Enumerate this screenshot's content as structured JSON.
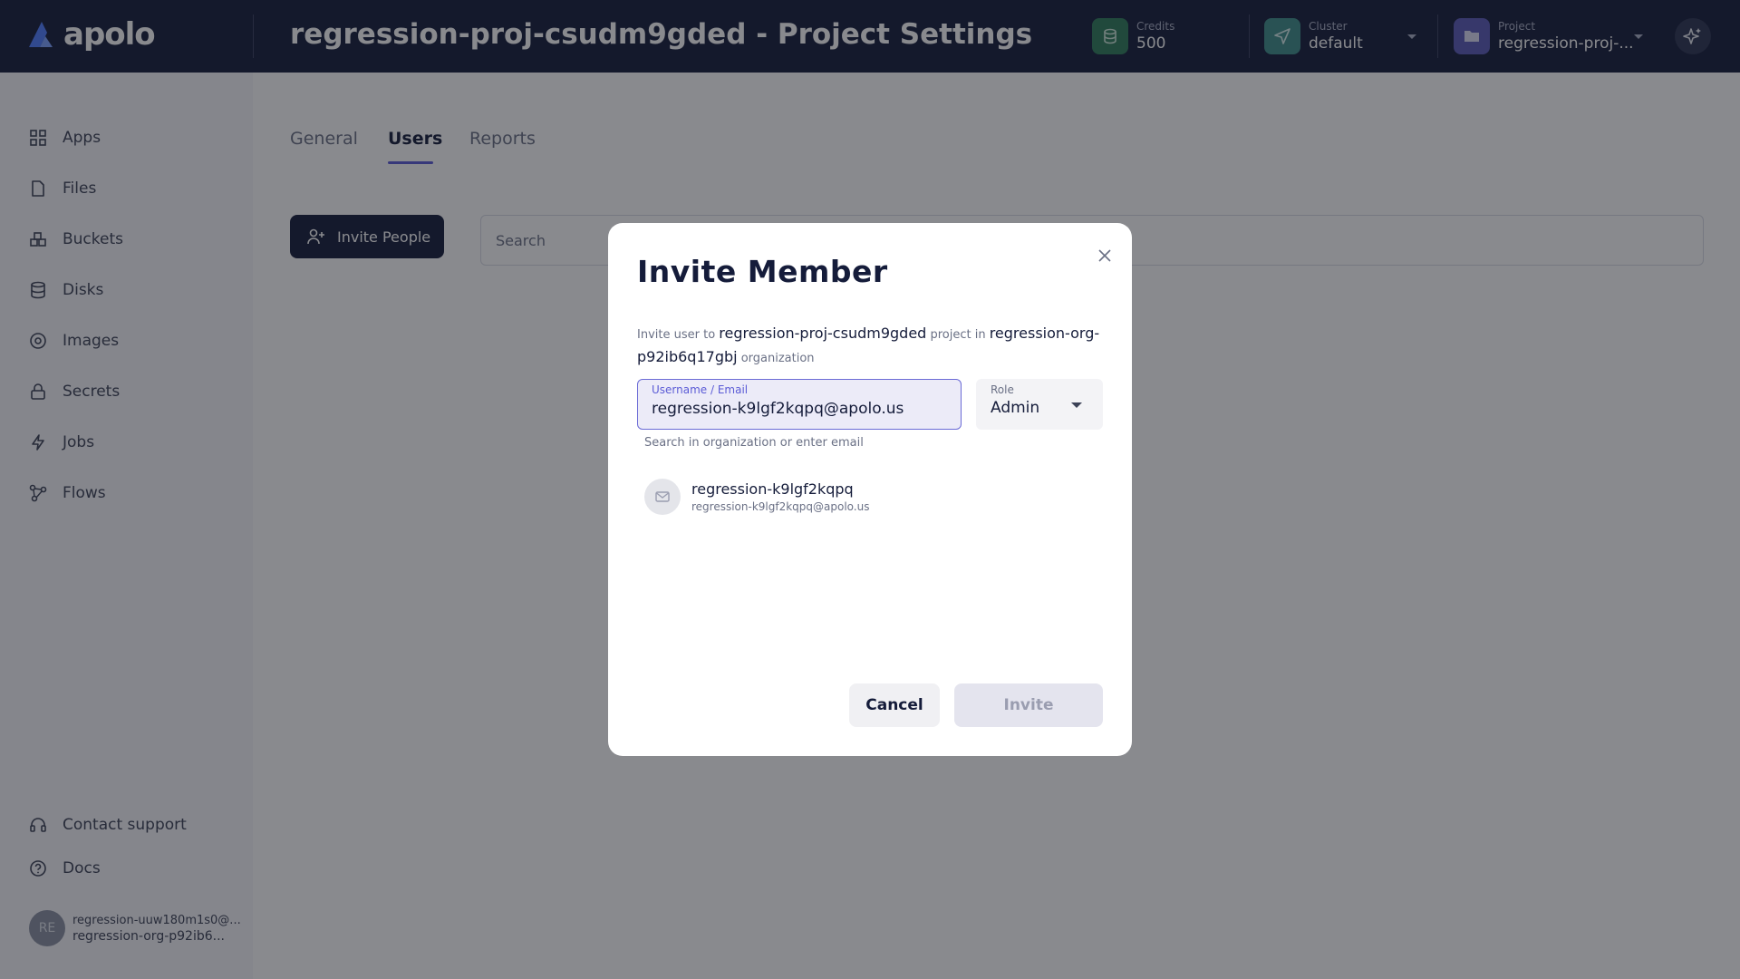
{
  "header": {
    "logo_text": "apolo",
    "title": "regression-proj-csudm9gded - Project Settings",
    "credits": {
      "label": "Credits",
      "value": "500"
    },
    "cluster": {
      "label": "Cluster",
      "value": "default"
    },
    "project": {
      "label": "Project",
      "value": "regression-proj-..."
    }
  },
  "sidebar": {
    "items": [
      {
        "label": "Apps",
        "icon": "apps-icon"
      },
      {
        "label": "Files",
        "icon": "file-icon"
      },
      {
        "label": "Buckets",
        "icon": "bucket-icon"
      },
      {
        "label": "Disks",
        "icon": "database-icon"
      },
      {
        "label": "Images",
        "icon": "image-icon"
      },
      {
        "label": "Secrets",
        "icon": "lock-icon"
      },
      {
        "label": "Jobs",
        "icon": "lightning-icon"
      },
      {
        "label": "Flows",
        "icon": "flow-icon"
      }
    ],
    "contact_support": "Contact support",
    "docs": "Docs",
    "user": {
      "initials": "RE",
      "email": "regression-uuw180m1s0@...",
      "org": "regression-org-p92ib6..."
    }
  },
  "main": {
    "tabs": [
      "General",
      "Users",
      "Reports"
    ],
    "active_tab": "Users",
    "invite_people_label": "Invite People",
    "search_placeholder": "Search"
  },
  "modal": {
    "title": "Invite Member",
    "desc_prefix": "Invite user to",
    "project_name": "regression-proj-csudm9gded",
    "desc_middle": "project in",
    "org_name": "regression-org-p92ib6q17gbj",
    "desc_suffix": "organization",
    "username_label": "Username / Email",
    "username_value": "regression-k9lgf2kqpq@apolo.us",
    "username_help": "Search in organization or enter email",
    "role_label": "Role",
    "role_value": "Admin",
    "suggestion": {
      "name": "regression-k9lgf2kqpq",
      "email": "regression-k9lgf2kqpq@apolo.us"
    },
    "cancel_label": "Cancel",
    "invite_label": "Invite"
  },
  "colors": {
    "header_bg": "#151c3a",
    "accent": "#5b5bd6",
    "credits_icon_bg": "#2e7d5b",
    "cluster_icon_bg": "#3f8f8a",
    "project_icon_bg": "#5a5ab8"
  }
}
